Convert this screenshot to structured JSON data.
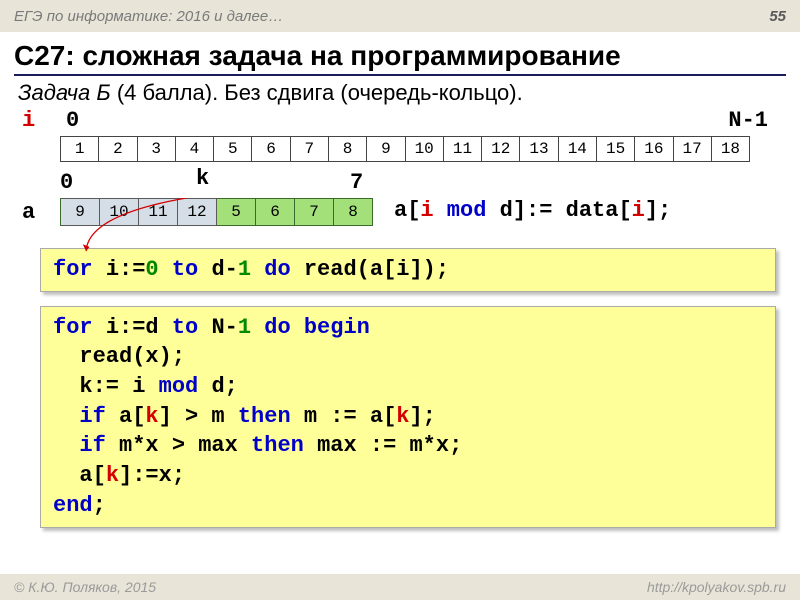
{
  "header": {
    "left": "ЕГЭ по информатике: 2016 и далее…",
    "page": "55"
  },
  "title": "C27: сложная задача на программирование",
  "subtitle": {
    "task": "Задача Б",
    "pts": " (4 балла). Без сдвига (очередь-кольцо)."
  },
  "row": {
    "i": "i",
    "zero": "0",
    "n": "N-1",
    "cells": [
      "1",
      "2",
      "3",
      "4",
      "5",
      "6",
      "7",
      "8",
      "9",
      "10",
      "11",
      "12",
      "13",
      "14",
      "15",
      "16",
      "17",
      "18"
    ]
  },
  "buffer": {
    "lbl0": "0",
    "lblk": "k",
    "lbl7": "7",
    "lbla": "a",
    "gray": [
      "9",
      "10",
      "11",
      "12"
    ],
    "green": [
      "5",
      "6",
      "7",
      "8"
    ],
    "assign_parts": {
      "p1": "a[",
      "p2": "i",
      "p3": " mod ",
      "p4": "d",
      "p5": "]:= data[",
      "p6": "i",
      "p7": "];"
    }
  },
  "code1": {
    "t1": "for ",
    "t2": "i:=",
    "t3": "0",
    "t4": " to ",
    "t5": "d-",
    "t6": "1",
    "t7": " do ",
    "t8": "read(a[i]);"
  },
  "code2": {
    "l1a": "for ",
    "l1b": "i:=d ",
    "l1c": "to ",
    "l1d": "N-",
    "l1e": "1",
    "l1f": " do begin",
    "l2": "  read(x);",
    "l3a": "  k:= i ",
    "l3b": "mod ",
    "l3c": "d;",
    "l4a": "  if ",
    "l4b": "a[",
    "l4c": "k",
    "l4d": "] > m ",
    "l4e": "then ",
    "l4f": "m := a[",
    "l4g": "k",
    "l4h": "];",
    "l5a": "  if ",
    "l5b": "m*x > max ",
    "l5c": "then ",
    "l5d": "max := m*x;",
    "l6a": "  a[",
    "l6b": "k",
    "l6c": "]:=x;",
    "l7": "end",
    "l7b": ";"
  },
  "footer": {
    "left": "© К.Ю. Поляков, 2015",
    "right": "http://kpolyakov.spb.ru"
  }
}
